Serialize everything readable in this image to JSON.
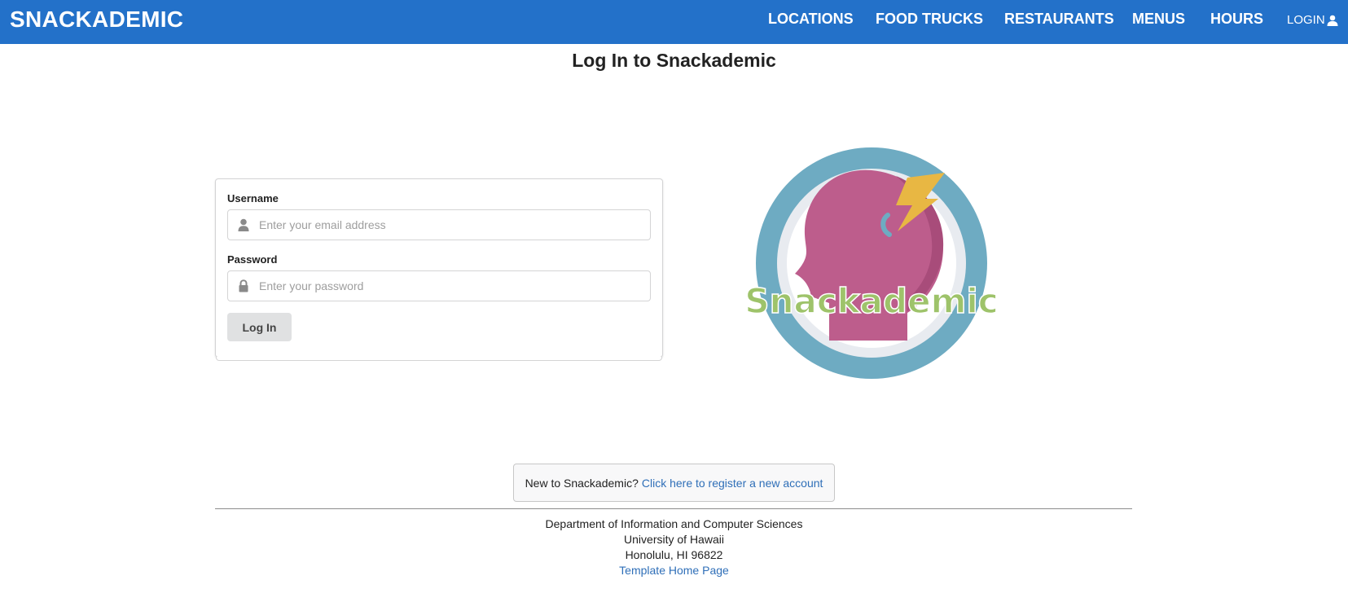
{
  "navbar": {
    "brand": "SNACKADEMIC",
    "items": [
      "LOCATIONS",
      "FOOD TRUCKS",
      "RESTAURANTS",
      "MENUS",
      "HOURS"
    ],
    "login_label": "LOGIN",
    "background_color": "#2371c9"
  },
  "page": {
    "title": "Log In to Snackademic"
  },
  "login_form": {
    "username_label": "Username",
    "username_placeholder": "Enter your email address",
    "username_icon": "user-icon",
    "password_label": "Password",
    "password_placeholder": "Enter your password",
    "password_icon": "lock-icon",
    "submit_label": "Log In"
  },
  "logo": {
    "text": "Snackademic"
  },
  "register": {
    "prompt": "New to Snackademic?",
    "link": "Click here to register a new account"
  },
  "footer": {
    "line1": "Department of Information and Computer Sciences",
    "line2": "University of Hawaii",
    "line3": "Honolulu, HI 96822",
    "link": "Template Home Page"
  }
}
